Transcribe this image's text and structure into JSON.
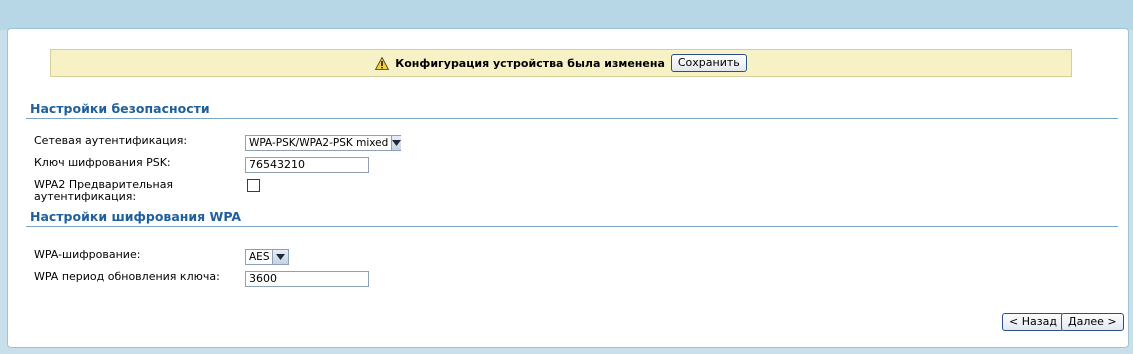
{
  "notice": {
    "text": "Конфигурация устройства была изменена",
    "save_label": "Сохранить"
  },
  "security": {
    "title": "Настройки безопасности",
    "auth_label": "Сетевая аутентификация:",
    "auth_value": "WPA-PSK/WPA2-PSK mixed",
    "psk_label": "Ключ шифрования PSK:",
    "psk_value": "76543210",
    "preauth_label_line1": "WPA2 Предварительная",
    "preauth_label_line2": "аутентификация:",
    "preauth_checked": false
  },
  "wpa": {
    "title": "Настройки шифрования WPA",
    "cipher_label": "WPA-шифрование:",
    "cipher_value": "AES",
    "rekey_label": "WPA период обновления ключа:",
    "rekey_value": "3600"
  },
  "nav": {
    "back_label": "< Назад",
    "next_label": "Далее >"
  },
  "colors": {
    "section_title": "#1f5f9a",
    "notice_bg": "#f7f1c6",
    "page_bg": "#c9dfe9"
  }
}
